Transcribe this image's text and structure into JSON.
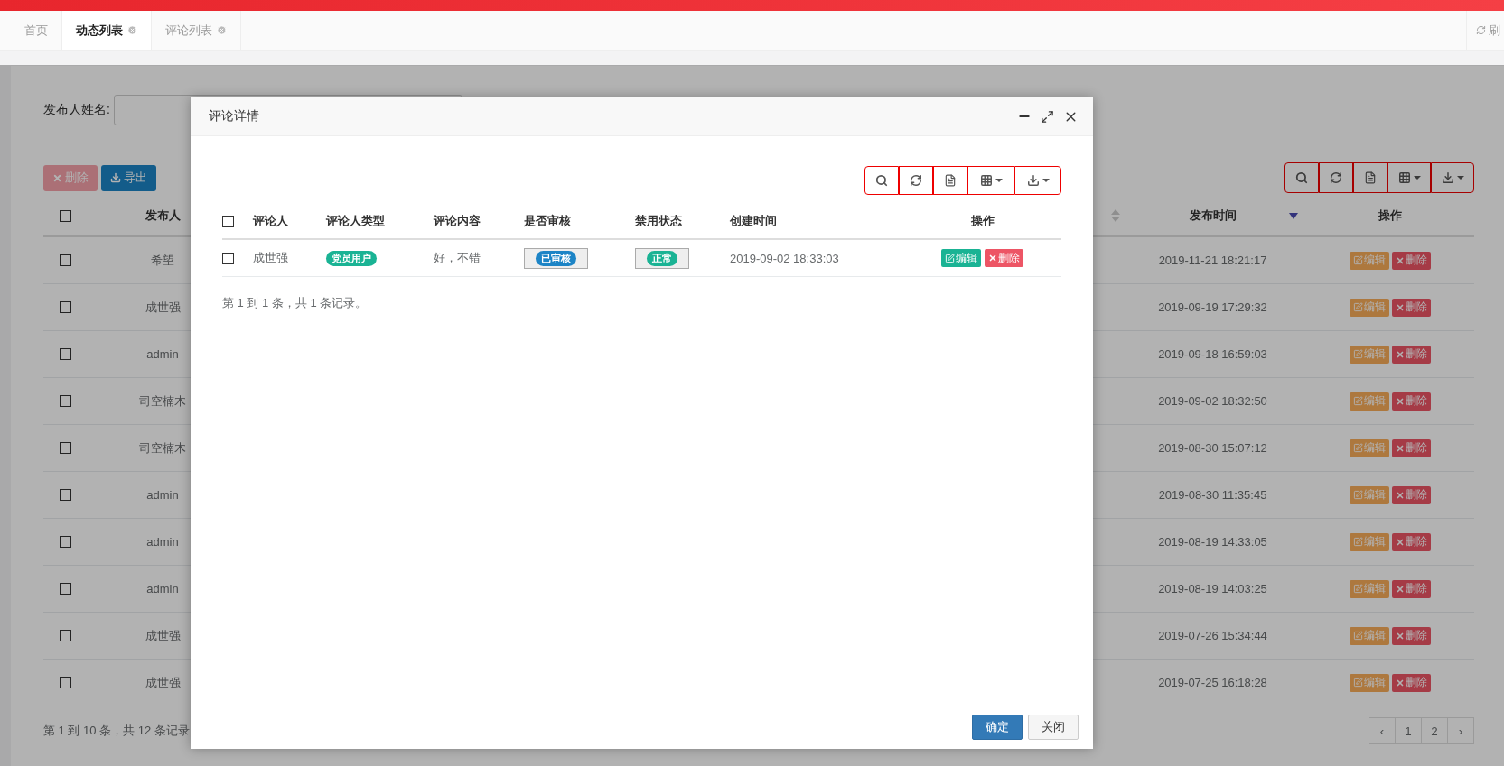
{
  "tabs": [
    {
      "label": "首页",
      "selected": false,
      "closable": false
    },
    {
      "label": "动态列表",
      "selected": true,
      "closable": true
    },
    {
      "label": "评论列表",
      "selected": false,
      "closable": true
    }
  ],
  "refresh": {
    "label": "刷"
  },
  "filter": {
    "label": "发布人姓名:"
  },
  "actions": [
    {
      "kind": "delete",
      "label": "删除",
      "disabled": true
    },
    {
      "kind": "export",
      "label": "导出",
      "disabled": false
    }
  ],
  "table": {
    "all_checked": false,
    "columns": [
      {
        "label": "发布人"
      },
      {
        "label": "发布时间",
        "sorted": true
      },
      {
        "label": "操作"
      }
    ],
    "rows": [
      {
        "checked": false,
        "publisher": "希望",
        "time": "2019-11-21 18:21:17",
        "edit": "编辑",
        "delete": "删除"
      },
      {
        "checked": false,
        "publisher": "成世强",
        "time": "2019-09-19 17:29:32",
        "edit": "编辑",
        "delete": "删除"
      },
      {
        "checked": false,
        "publisher": "admin",
        "time": "2019-09-18 16:59:03",
        "edit": "编辑",
        "delete": "删除"
      },
      {
        "checked": false,
        "publisher": "司空楠木",
        "time": "2019-09-02 18:32:50",
        "edit": "编辑",
        "delete": "删除"
      },
      {
        "checked": false,
        "publisher": "司空楠木",
        "time": "2019-08-30 15:07:12",
        "edit": "编辑",
        "delete": "删除"
      },
      {
        "checked": false,
        "publisher": "admin",
        "time": "2019-08-30 11:35:45",
        "edit": "编辑",
        "delete": "删除"
      },
      {
        "checked": false,
        "publisher": "admin",
        "time": "2019-08-19 14:33:05",
        "edit": "编辑",
        "delete": "删除"
      },
      {
        "checked": false,
        "publisher": "admin",
        "time": "2019-08-19 14:03:25",
        "edit": "编辑",
        "delete": "删除"
      },
      {
        "checked": false,
        "publisher": "成世强",
        "time": "2019-07-26 15:34:44",
        "edit": "编辑",
        "delete": "删除"
      },
      {
        "checked": false,
        "publisher": "成世强",
        "time": "2019-07-25 16:18:28",
        "edit": "编辑",
        "delete": "删除"
      }
    ],
    "summary": "第 1 到 10 条，共 12 条记录",
    "pagination": [
      {
        "label": "‹",
        "selected": false
      },
      {
        "label": "1",
        "selected": false
      },
      {
        "label": "2",
        "selected": false
      },
      {
        "label": "›",
        "selected": false
      }
    ]
  },
  "dialog": {
    "title": "评论详情",
    "all_checked": false,
    "columns": [
      "评论人",
      "评论人类型",
      "评论内容",
      "是否审核",
      "禁用状态",
      "创建时间",
      "操作"
    ],
    "rows": [
      {
        "checked": false,
        "commenter": "成世强",
        "type": "党员用户",
        "content": "好，不错",
        "audit": {
          "label": "已审核",
          "color": "#1c84c6"
        },
        "status": {
          "label": "正常",
          "color": "#1ab394"
        },
        "created": "2019-09-02 18:33:03",
        "edit": "编辑",
        "delete": "删除"
      }
    ],
    "summary": "第 1 到 1 条，共 1 条记录。",
    "buttons": [
      {
        "kind": "primary",
        "label": "确定"
      },
      {
        "kind": "default",
        "label": "关闭"
      }
    ]
  }
}
